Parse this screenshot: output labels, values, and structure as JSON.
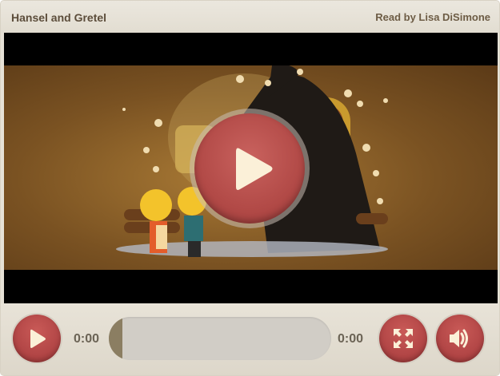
{
  "header": {
    "title": "Hansel and Gretel",
    "narrator": "Read by Lisa DiSimone"
  },
  "player": {
    "big_play_icon": "play-icon",
    "play_icon": "play-icon",
    "fullscreen_icon": "fullscreen-icon",
    "volume_icon": "volume-icon",
    "current_time": "0:00",
    "duration": "0:00",
    "progress": 0.06
  },
  "colors": {
    "accent": "#b24646",
    "frame": "#e6e1d6",
    "progress_track": "#d1cdc6",
    "progress_fill": "#8b7e62",
    "title_text": "#5c4d3b"
  }
}
